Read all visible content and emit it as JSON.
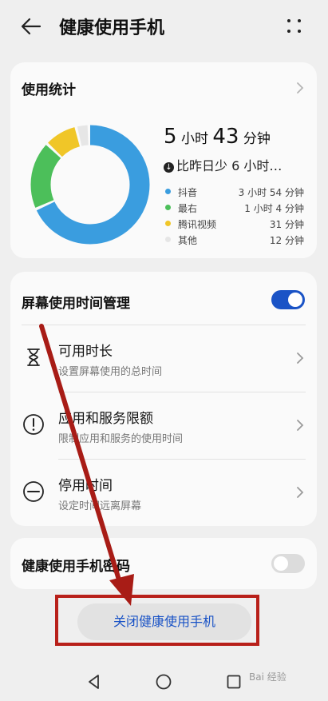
{
  "header": {
    "title": "健康使用手机",
    "back_icon": "arrow-left-icon",
    "menu_icon": "more-dots-icon"
  },
  "usage": {
    "title": "使用统计",
    "total_hours": "5",
    "hours_unit": "小时",
    "total_minutes": "43",
    "minutes_unit": "分钟",
    "compare_text": "比昨日少 6 小时…",
    "apps": [
      {
        "name": "抖音",
        "time": "3 小时 54 分钟",
        "minutes": 234,
        "color": "#3a9ddf"
      },
      {
        "name": "最右",
        "time": "1 小时 4 分钟",
        "minutes": 64,
        "color": "#4cbf5a"
      },
      {
        "name": "腾讯视频",
        "time": "31 分钟",
        "minutes": 31,
        "color": "#f0c628"
      },
      {
        "name": "其他",
        "time": "12 分钟",
        "minutes": 12,
        "color": "#e6e6e6"
      }
    ]
  },
  "screen_time": {
    "title": "屏幕使用时间管理",
    "enabled": true,
    "rows": [
      {
        "title": "可用时长",
        "subtitle": "设置屏幕使用的总时间",
        "icon": "hourglass-icon"
      },
      {
        "title": "应用和服务限额",
        "subtitle": "限制应用和服务的使用时间",
        "icon": "alert-circle-icon"
      },
      {
        "title": "停用时间",
        "subtitle": "设定时间远离屏幕",
        "icon": "minus-circle-icon"
      }
    ]
  },
  "password": {
    "label": "健康使用手机密码",
    "enabled": false
  },
  "close_button": {
    "label": "关闭健康使用手机"
  },
  "colors": {
    "accent": "#1a53c6",
    "toggle_on": "#1a53c6",
    "toggle_off": "#dcdcdc",
    "annotation_red": "#b8201a"
  },
  "nav": {
    "back": "triangle-back-icon",
    "home": "circle-home-icon",
    "recents": "square-recents-icon"
  },
  "watermark": "Bai 经验"
}
